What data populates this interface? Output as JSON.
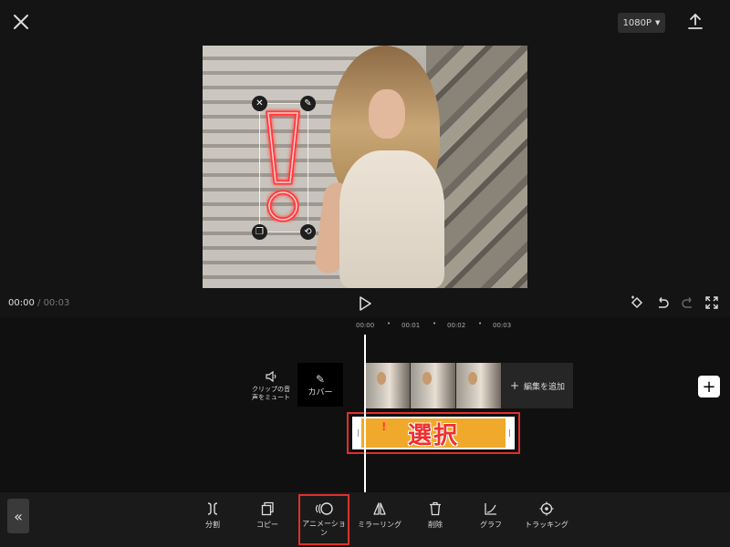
{
  "header": {
    "resolution": "1080P"
  },
  "player": {
    "current_time": "00:00",
    "separator": " / ",
    "total_time": "00:03"
  },
  "ruler": {
    "ticks": [
      "00:00",
      "00:01",
      "00:02",
      "00:03"
    ]
  },
  "timeline": {
    "mute_label": "クリップの音声をミュート",
    "cover_label": "カバー",
    "add_edit_label": "編集を追加",
    "sticker_text": "選択"
  },
  "toolbar": {
    "items": [
      {
        "label": "分割",
        "icon": "split-icon"
      },
      {
        "label": "コピー",
        "icon": "copy-icon"
      },
      {
        "label": "アニメーション",
        "icon": "animation-icon"
      },
      {
        "label": "ミラーリング",
        "icon": "mirror-icon"
      },
      {
        "label": "削除",
        "icon": "delete-icon"
      },
      {
        "label": "グラフ",
        "icon": "graph-icon"
      },
      {
        "label": "トラッキング",
        "icon": "tracking-icon"
      }
    ]
  },
  "colors": {
    "accent_red": "#e0302c",
    "sticker_track": "#f0a92a",
    "neon": "#ff3b3b"
  }
}
